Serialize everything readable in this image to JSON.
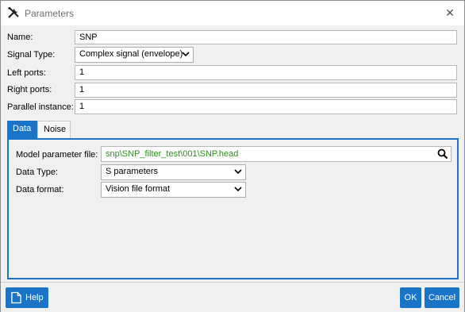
{
  "window": {
    "title": "Parameters",
    "close_label": "✕"
  },
  "form": {
    "name_label": "Name:",
    "name_value": "SNP",
    "signal_type_label": "Signal Type:",
    "signal_type_value": "Complex signal (envelope)",
    "left_ports_label": "Left ports:",
    "left_ports_value": "1",
    "right_ports_label": "Right ports:",
    "right_ports_value": "1",
    "parallel_label": "Parallel instance:",
    "parallel_value": "1"
  },
  "tabs": [
    {
      "label": "Data",
      "active": true
    },
    {
      "label": "Noise",
      "active": false
    }
  ],
  "data_tab": {
    "model_file_label": "Model parameter file:",
    "model_file_value": "snp\\SNP_filter_test\\001\\SNP.head",
    "data_type_label": "Data Type:",
    "data_type_value": "S parameters",
    "data_format_label": "Data format:",
    "data_format_value": "Vision file format"
  },
  "buttons": {
    "help": "Help",
    "ok": "OK",
    "cancel": "Cancel"
  },
  "colors": {
    "accent": "#1a74c8",
    "file_text": "#2f8f1f"
  },
  "icons": {
    "title": "tools-icon",
    "help": "document-icon",
    "search": "search-icon"
  }
}
